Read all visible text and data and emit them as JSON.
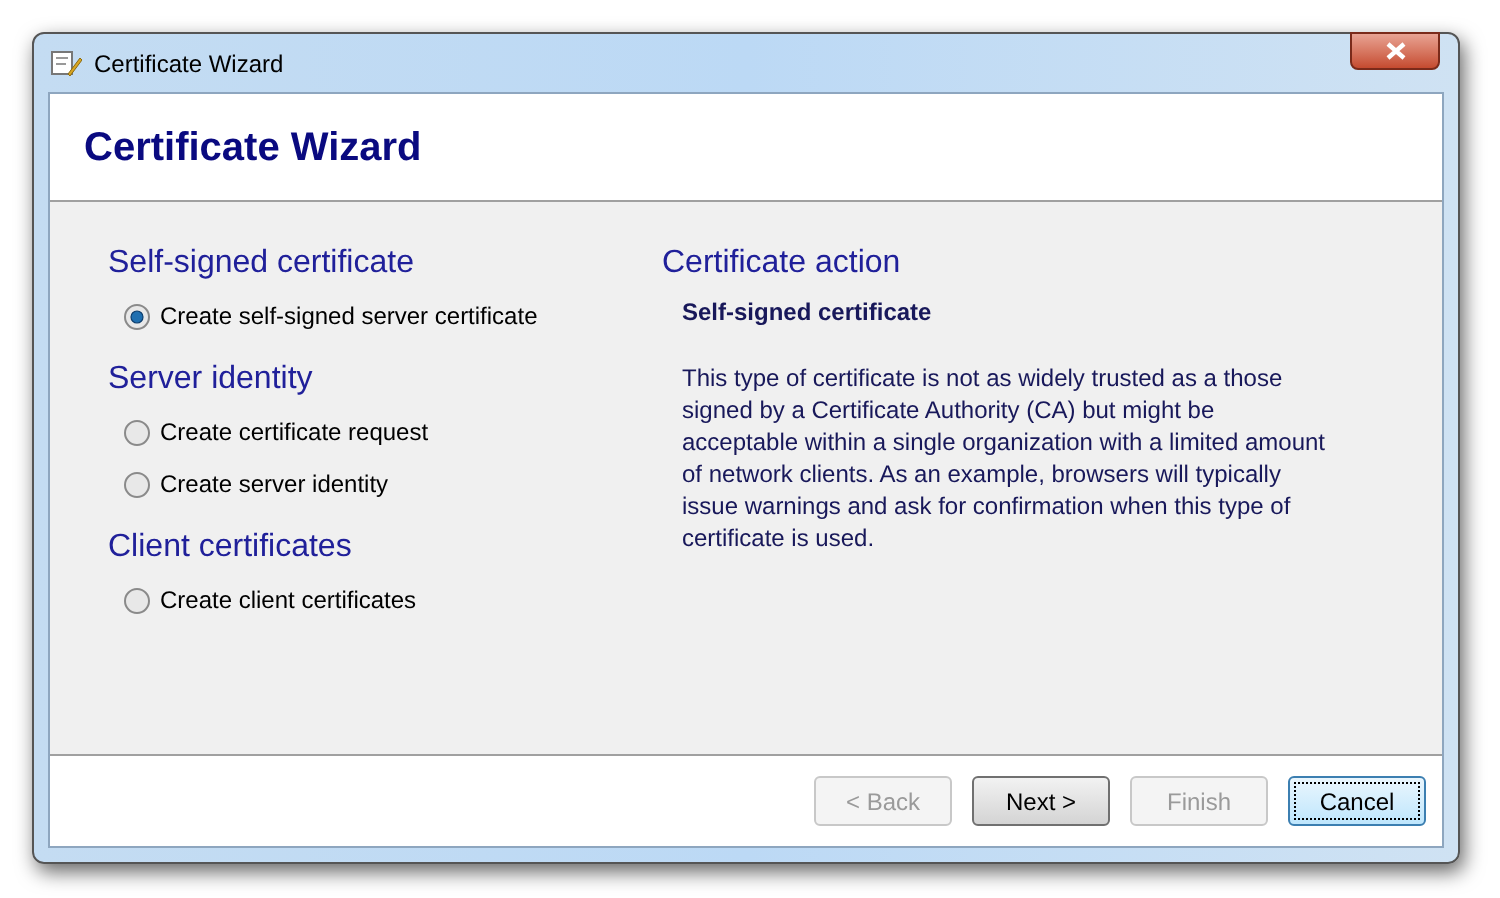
{
  "window": {
    "title": "Certificate Wizard"
  },
  "header": {
    "title": "Certificate Wizard"
  },
  "groups": [
    {
      "heading": "Self-signed certificate",
      "options": [
        {
          "label": "Create self-signed server certificate",
          "selected": true
        }
      ]
    },
    {
      "heading": "Server identity",
      "options": [
        {
          "label": "Create certificate request",
          "selected": false
        },
        {
          "label": "Create server identity",
          "selected": false
        }
      ]
    },
    {
      "heading": "Client certificates",
      "options": [
        {
          "label": "Create client certificates",
          "selected": false
        }
      ]
    }
  ],
  "action": {
    "heading": "Certificate action",
    "title": "Self-signed certificate",
    "description": "This type of certificate is not as widely trusted as a those signed by a Certificate Authority (CA) but might be acceptable within a single organization with a limited amount of network clients. As an example, browsers will typically issue warnings and ask for confirmation when this type of certificate is used."
  },
  "buttons": [
    {
      "label": "< Back",
      "disabled": true,
      "focused": false
    },
    {
      "label": "Next >",
      "disabled": false,
      "focused": false
    },
    {
      "label": "Finish",
      "disabled": true,
      "focused": false
    },
    {
      "label": "Cancel",
      "disabled": false,
      "focused": true
    }
  ]
}
